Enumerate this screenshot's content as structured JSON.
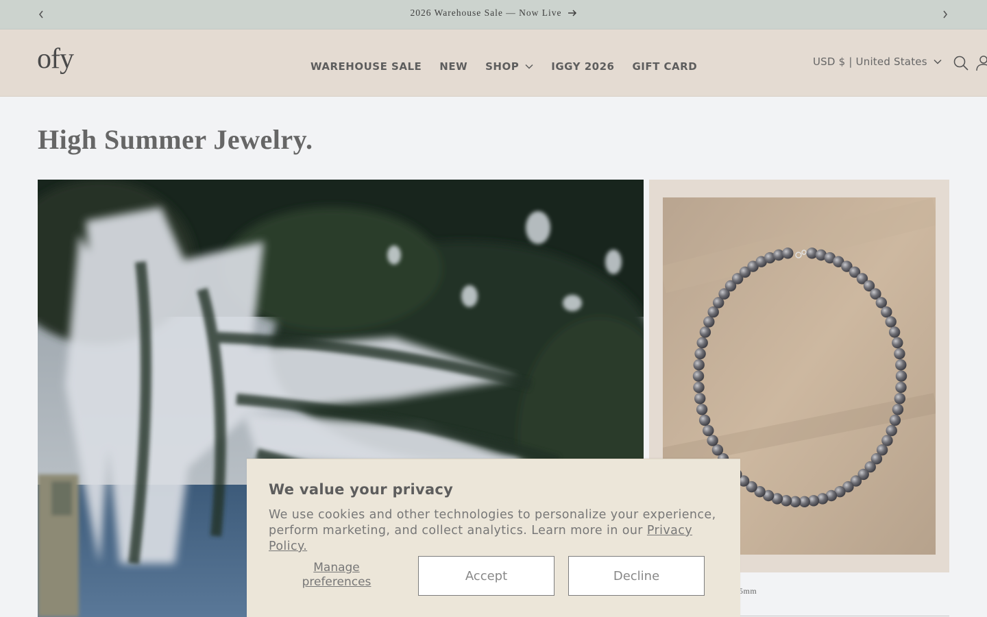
{
  "announcement": {
    "message": "2026 Warehouse Sale — Now Live",
    "prev_icon": "chevron-left-icon",
    "next_icon": "chevron-right-icon",
    "arrow_icon": "arrow-right-icon"
  },
  "header": {
    "logo": "ofy",
    "nav": [
      {
        "label": "WAREHOUSE SALE"
      },
      {
        "label": "NEW"
      },
      {
        "label": "SHOP",
        "has_dropdown": true
      },
      {
        "label": "IGGY 2026"
      },
      {
        "label": "GIFT CARD"
      }
    ],
    "locale": "USD $ | United States",
    "search_icon": "search-icon",
    "account_icon": "account-icon"
  },
  "main": {
    "title": "High Summer Jewelry.",
    "product_caption_partial": "5mm"
  },
  "cookie_banner": {
    "title": "We value your privacy",
    "body": "We use cookies and other technologies to personalize your experience, perform marketing, and collect analytics. Learn more in our ",
    "privacy_link": "Privacy Policy.",
    "manage_label": "Manage preferences",
    "accept_label": "Accept",
    "decline_label": "Decline"
  },
  "colors": {
    "announcement_bg": "#ccd3ce",
    "header_bg": "#e4dbd2",
    "page_bg": "#f2f3f5",
    "cookie_bg": "#ece6d9"
  }
}
